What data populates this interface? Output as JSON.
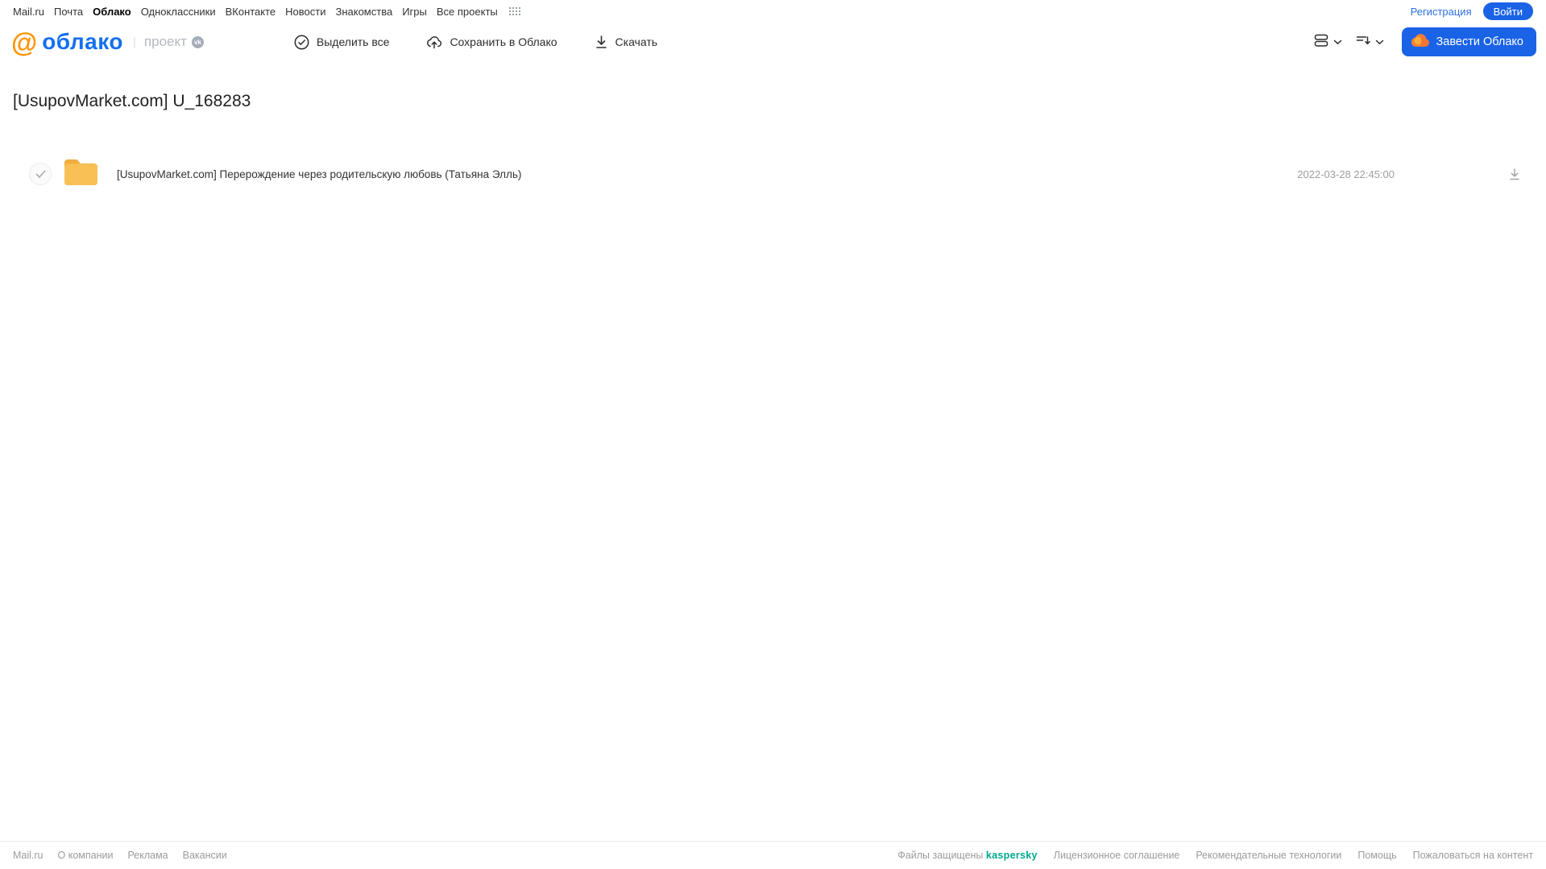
{
  "topnav": {
    "links": [
      {
        "label": "Mail.ru",
        "active": false
      },
      {
        "label": "Почта",
        "active": false
      },
      {
        "label": "Облако",
        "active": true
      },
      {
        "label": "Одноклассники",
        "active": false
      },
      {
        "label": "ВКонтакте",
        "active": false
      },
      {
        "label": "Новости",
        "active": false
      },
      {
        "label": "Знакомства",
        "active": false
      },
      {
        "label": "Игры",
        "active": false
      },
      {
        "label": "Все проекты",
        "active": false
      }
    ],
    "register_label": "Регистрация",
    "login_label": "Войти"
  },
  "header": {
    "logo_at": "@",
    "logo_text": "облако",
    "project_label": "проект",
    "vk_badge": "vk",
    "toolbar": {
      "select_all_label": "Выделить все",
      "save_to_cloud_label": "Сохранить в Облако",
      "download_label": "Скачать"
    },
    "get_cloud_label": "Завести Облако"
  },
  "page": {
    "title": "[UsupovMarket.com] U_168283"
  },
  "files": [
    {
      "type": "folder",
      "name": "[UsupovMarket.com] Перерождение через родительскую любовь (Татьяна Элль)",
      "date": "2022-03-28 22:45:00"
    }
  ],
  "footer": {
    "left_links": [
      "Mail.ru",
      "О компании",
      "Реклама",
      "Вакансии"
    ],
    "protected_label": "Файлы защищены",
    "kaspersky_label": "kaspersky",
    "right_links": [
      "Лицензионное соглашение",
      "Рекомендательные технологии",
      "Помощь",
      "Пожаловаться на контент"
    ]
  },
  "colors": {
    "accent_blue": "#1b63e6",
    "link_blue": "#2d6fe5",
    "logo_orange": "#ff9400",
    "logo_blue": "#1470ef",
    "folder_yellow": "#f7bd4a",
    "kaspersky_teal": "#00a88e"
  }
}
